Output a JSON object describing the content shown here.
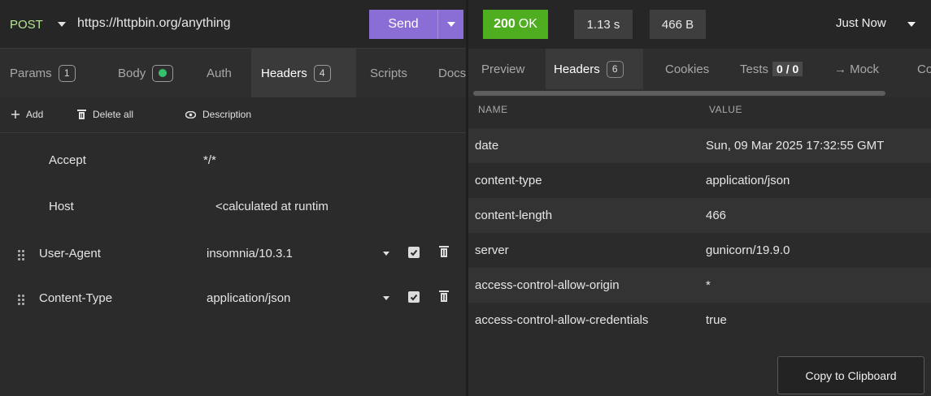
{
  "request": {
    "method": "POST",
    "url": "https://httpbin.org/anything",
    "send_label": "Send",
    "tabs": [
      {
        "label": "Params",
        "badge": "1"
      },
      {
        "label": "Body"
      },
      {
        "label": "Auth"
      },
      {
        "label": "Headers",
        "badge": "4"
      },
      {
        "label": "Scripts"
      },
      {
        "label": "Docs"
      }
    ],
    "toolbar": {
      "add": "Add",
      "delete_all": "Delete all",
      "description": "Description"
    },
    "default_headers": [
      {
        "name": "Accept",
        "value": "*/*"
      },
      {
        "name": "Host",
        "value": "<calculated at runtim"
      }
    ],
    "custom_headers": [
      {
        "name": "User-Agent",
        "value": "insomnia/10.3.1"
      },
      {
        "name": "Content-Type",
        "value": "application/json"
      }
    ]
  },
  "response": {
    "status_code": "200",
    "status_text": "OK",
    "time": "1.13 s",
    "size": "466 B",
    "history": "Just Now",
    "tabs": [
      {
        "label": "Preview"
      },
      {
        "label": "Headers",
        "badge": "6"
      },
      {
        "label": "Cookies"
      },
      {
        "label": "Tests",
        "score": "0 / 0"
      },
      {
        "label": "→ Mock"
      },
      {
        "label": "Co"
      }
    ],
    "columns": {
      "name": "NAME",
      "value": "VALUE"
    },
    "headers": [
      {
        "name": "date",
        "value": "Sun, 09 Mar 2025 17:32:55 GMT"
      },
      {
        "name": "content-type",
        "value": "application/json"
      },
      {
        "name": "content-length",
        "value": "466"
      },
      {
        "name": "server",
        "value": "gunicorn/19.9.0"
      },
      {
        "name": "access-control-allow-origin",
        "value": "*"
      },
      {
        "name": "access-control-allow-credentials",
        "value": "true"
      }
    ],
    "copy_label": "Copy to Clipboard"
  },
  "colors": {
    "method": "#b5e890",
    "send": "#8a6ed6",
    "status_ok": "#4fae1f",
    "body_dot": "#33c16d"
  }
}
